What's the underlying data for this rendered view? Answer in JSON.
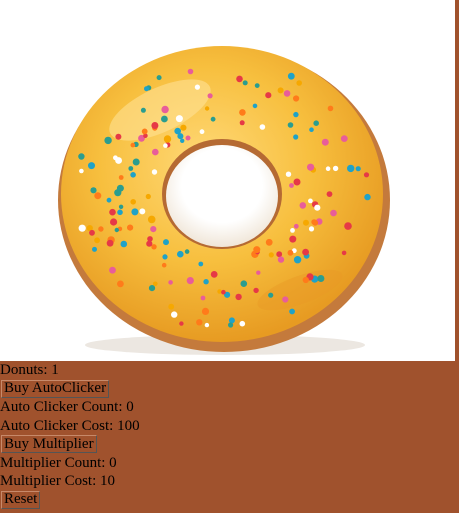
{
  "donuts": {
    "label": "Donuts:",
    "count": "1"
  },
  "autoclicker": {
    "buy_label": "Buy AutoClicker",
    "count_label": "Auto Clicker Count:",
    "count": "0",
    "cost_label": "Auto Clicker Cost:",
    "cost": "100"
  },
  "multiplier": {
    "buy_label": "Buy Multiplier",
    "count_label": "Multiplier Count:",
    "count": "0",
    "cost_label": "Multiplier Cost:",
    "cost": "10"
  },
  "reset_label": "Reset",
  "colors": {
    "page_background": "#a0522d",
    "glaze": "#f6bf3a",
    "dough": "#c0783c"
  },
  "donut_image": "glazed-donut-with-sprinkles"
}
